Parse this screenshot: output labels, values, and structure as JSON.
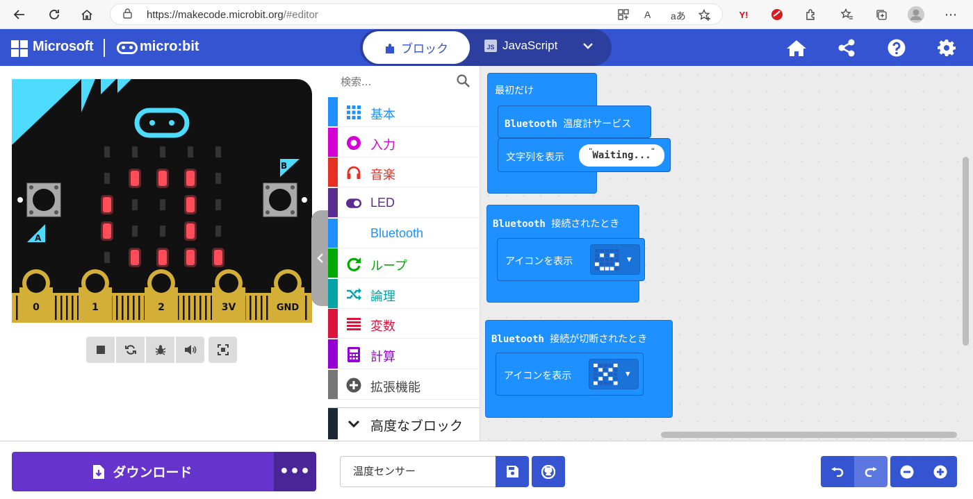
{
  "browser": {
    "url_host": "https://makecode.microbit.org",
    "url_path": "/#editor",
    "read_aloud": "A",
    "translate": "aあ",
    "yahoo": "Y!"
  },
  "header": {
    "brand": "Microsoft",
    "product": "micro:bit",
    "tab_blocks": "ブロック",
    "tab_js": "JavaScript",
    "js_badge": "JS"
  },
  "board": {
    "label_a": "A",
    "label_b": "B",
    "pins": [
      "0",
      "1",
      "2",
      "3V",
      "GND"
    ],
    "led_pattern": [
      [
        0,
        0,
        0,
        0,
        0
      ],
      [
        0,
        1,
        1,
        1,
        0
      ],
      [
        1,
        0,
        0,
        1,
        0
      ],
      [
        1,
        0,
        0,
        1,
        0
      ],
      [
        0,
        1,
        1,
        1,
        1
      ]
    ],
    "led_on_color": "#ff4d5a",
    "led_off_color": "#333333"
  },
  "toolbox": {
    "search_placeholder": "検索...",
    "categories": [
      {
        "label": "基本",
        "color": "#1e90ff",
        "icon": "grid-icon"
      },
      {
        "label": "入力",
        "color": "#d400d4",
        "icon": "radio-icon"
      },
      {
        "label": "音楽",
        "color": "#e63022",
        "icon": "headphones-icon"
      },
      {
        "label": "LED",
        "color": "#5c2d91",
        "icon": "toggle-icon"
      },
      {
        "label": "Bluetooth",
        "color": "#1e90ff",
        "icon": ""
      },
      {
        "label": "ループ",
        "color": "#00aa00",
        "icon": "loop-icon"
      },
      {
        "label": "論理",
        "color": "#00a4a6",
        "icon": "shuffle-icon"
      },
      {
        "label": "変数",
        "color": "#dc143c",
        "icon": "lines-icon"
      },
      {
        "label": "計算",
        "color": "#9400d3",
        "icon": "calculator-icon"
      },
      {
        "label": "拡張機能",
        "color": "#777777",
        "icon": "plus-circle-icon"
      }
    ],
    "advanced": "高度なブロック"
  },
  "blocks": {
    "on_start": "最初だけ",
    "bt_temp_service_kw": "Bluetooth",
    "bt_temp_service": "温度計サービス",
    "show_string": "文字列を表示",
    "string_value": "Waiting...",
    "on_connected_kw": "Bluetooth",
    "on_connected": "接続されたとき",
    "show_icon_1": "アイコンを表示",
    "on_disconnected_kw": "Bluetooth",
    "on_disconnected": "接続が切断されたとき",
    "show_icon_2": "アイコンを表示",
    "icon_happy": [
      [
        0,
        0,
        0,
        0,
        0
      ],
      [
        0,
        1,
        0,
        1,
        0
      ],
      [
        0,
        0,
        0,
        0,
        0
      ],
      [
        1,
        0,
        0,
        0,
        1
      ],
      [
        0,
        1,
        1,
        1,
        0
      ]
    ],
    "icon_no": [
      [
        1,
        0,
        0,
        0,
        1
      ],
      [
        0,
        1,
        0,
        1,
        0
      ],
      [
        0,
        0,
        1,
        0,
        0
      ],
      [
        0,
        1,
        0,
        1,
        0
      ],
      [
        1,
        0,
        0,
        0,
        1
      ]
    ]
  },
  "bottom": {
    "download": "ダウンロード",
    "more": "•••",
    "project_name": "温度センサー"
  },
  "colors": {
    "header_blue": "#3454d1",
    "block_blue": "#1e90ff",
    "download_purple": "#6633cc"
  }
}
